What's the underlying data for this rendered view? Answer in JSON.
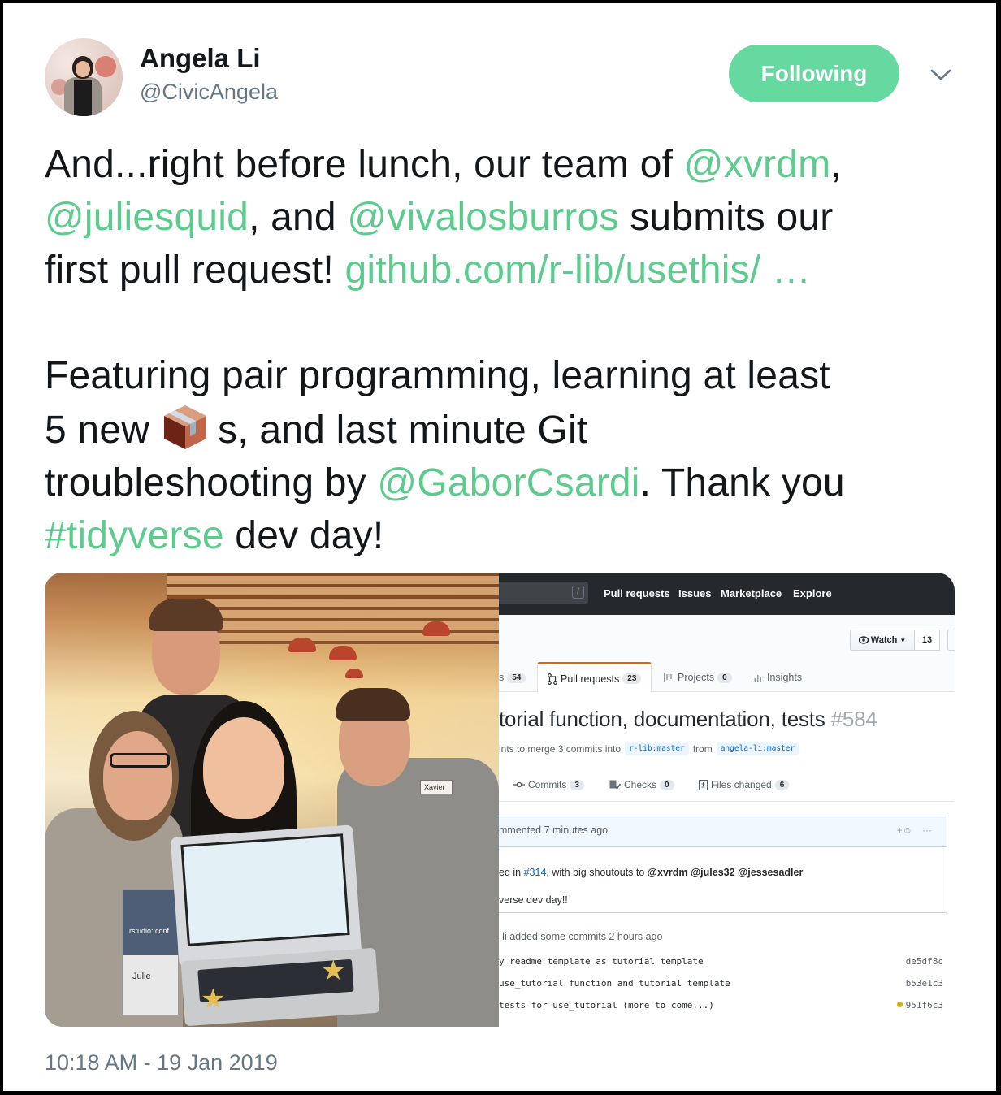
{
  "author": {
    "name": "Angela Li",
    "handle": "@CivicAngela",
    "avatar_icon": "profile-photo"
  },
  "follow_button": {
    "label": "Following",
    "color": "#66d9a1"
  },
  "menu_icon": "chevron-down-icon",
  "tweet": {
    "link_color": "#5ecb8e",
    "paragraph1": {
      "seg1": "And...right before lunch, our team of ",
      "mention1": "@xvrdm",
      "seg2": ",",
      "mention2": "@juliesquid",
      "seg3": ", and ",
      "mention3": "@vivalosburros",
      "seg4": " submits our",
      "seg5": "first pull request! ",
      "url": "github.com/r-lib/usethis/ …"
    },
    "paragraph2": {
      "seg1": "Featuring pair programming, learning at least",
      "seg2": "5 new",
      "emoji": "package-emoji",
      "seg3": "s, and last minute Git",
      "seg4": "troubleshooting by ",
      "mention": "@GaborCsardi",
      "seg5": ". Thank you",
      "hashtag": "#tidyverse",
      "seg6": " dev day!"
    }
  },
  "media": {
    "photo": {
      "description": "Group photo of four people holding a laptop showing the pull request",
      "badge_text": "rstudio::conf",
      "badge_name": "Julie",
      "name_tag": "Xavier"
    },
    "github": {
      "nav": {
        "search_shortcut": "/",
        "links": [
          "Pull requests",
          "Issues",
          "Marketplace",
          "Explore"
        ]
      },
      "watch": {
        "label": "Watch",
        "count": "13"
      },
      "repo_tabs": [
        {
          "label": "s",
          "count": "54"
        },
        {
          "label": "Pull requests",
          "count": "23",
          "active": true
        },
        {
          "label": "Projects",
          "count": "0"
        },
        {
          "label": "Insights"
        }
      ],
      "pr_title": "torial function, documentation, tests",
      "pr_number": "#584",
      "pr_meta": {
        "text": "ints to merge 3 commits into",
        "base": "r-lib:master",
        "from": "from",
        "head": "angela-li:master"
      },
      "pr_tabs": [
        {
          "label": "Commits",
          "count": "3"
        },
        {
          "label": "Checks",
          "count": "0"
        },
        {
          "label": "Files changed",
          "count": "6"
        }
      ],
      "comment": {
        "header": "mmented 7 minutes ago",
        "line1_pre": "ed in ",
        "line1_ref": "#314",
        "line1_mid": ", with big shoutouts to ",
        "line1_mentions": "@xvrdm @jules32 @jessesadler",
        "line2": "verse dev day!!"
      },
      "commits_header": "-li added some commits 2 hours ago",
      "commits": [
        {
          "message": "y readme template as tutorial template",
          "sha": "de5df8c",
          "status": ""
        },
        {
          "message": " use_tutorial function and tutorial template",
          "sha": "b53e1c3",
          "status": ""
        },
        {
          "message": " tests for use_tutorial (more to come...)",
          "sha": "951f6c3",
          "status": "pending"
        }
      ]
    }
  },
  "timestamp": "10:18 AM - 19 Jan 2019"
}
